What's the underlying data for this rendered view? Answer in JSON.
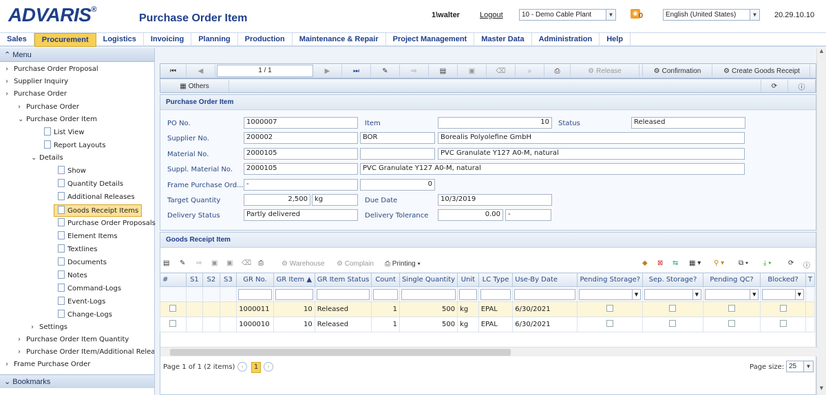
{
  "header": {
    "logo": "ADVARIS",
    "reg": "®",
    "title": "Purchase Order Item",
    "user": "1\\walter",
    "logout": "Logout",
    "plant": "10 - Demo Cable Plant",
    "notif_count": "0",
    "language": "English (United States)",
    "version": "20.29.10.10"
  },
  "menubar": [
    "Sales",
    "Procurement",
    "Logistics",
    "Invoicing",
    "Planning",
    "Production",
    "Maintenance & Repair",
    "Project Management",
    "Master Data",
    "Administration",
    "Help"
  ],
  "sidebar": {
    "menu": "Menu",
    "bookmarks": "Bookmarks",
    "items": [
      "Purchase Order Proposal",
      "Supplier Inquiry",
      "Purchase Order",
      "Purchase Order",
      "Purchase Order Item",
      "List View",
      "Report Layouts",
      "Details",
      "Show",
      "Quantity Details",
      "Additional Releases",
      "Goods Receipt Items",
      "Purchase Order Proposals",
      "Element Items",
      "Textlines",
      "Documents",
      "Notes",
      "Command-Logs",
      "Event-Logs",
      "Change-Logs",
      "Settings",
      "Purchase Order Item Quantity",
      "Purchase Order Item/Additional Releases",
      "Frame Purchase Order"
    ]
  },
  "toolbar": {
    "page": "1 / 1",
    "release": "Release",
    "confirmation": "Confirmation",
    "create_gr": "Create Goods Receipt",
    "others": "Others"
  },
  "form": {
    "section": "Purchase Order Item",
    "po_no_l": "PO No.",
    "po_no": "1000007",
    "item_l": "Item",
    "item": "10",
    "status_l": "Status",
    "status": "Released",
    "supplier_l": "Supplier No.",
    "supplier": "200002",
    "supplier_code": "BOR",
    "supplier_name": "Borealis Polyolefine GmbH",
    "material_l": "Material No.",
    "material": "2000105",
    "material_name": "PVC Granulate Y127 A0-M, natural",
    "suppl_mat_l": "Suppl. Material No.",
    "suppl_mat": "2000105",
    "suppl_mat_name": "PVC Granulate Y127 A0-M, natural",
    "frame_l": "Frame Purchase Ord...",
    "frame": "-",
    "frame_val": "0",
    "target_l": "Target Quantity",
    "target": "2,500",
    "unit": "kg",
    "due_l": "Due Date",
    "due": "10/3/2019",
    "dstatus_l": "Delivery Status",
    "dstatus": "Partly delivered",
    "tol_l": "Delivery Tolerance",
    "tol": "0.00",
    "tol_unit": "-"
  },
  "grid": {
    "section": "Goods Receipt Item",
    "warehouse": "Warehouse",
    "complain": "Complain",
    "printing": "Printing",
    "columns": [
      "#",
      "S1",
      "S2",
      "S3",
      "GR No.",
      "GR Item",
      "GR Item Status",
      "Count",
      "Single Quantity",
      "Unit",
      "LC Type",
      "Use-By Date",
      "Pending Storage?",
      "Sep. Storage?",
      "Pending QC?",
      "Blocked?",
      "T"
    ],
    "rows": [
      [
        "1000011",
        "10",
        "Released",
        "1",
        "500",
        "kg",
        "EPAL",
        "6/30/2021"
      ],
      [
        "1000010",
        "10",
        "Released",
        "1",
        "500",
        "kg",
        "EPAL",
        "6/30/2021"
      ]
    ],
    "footer": "Page 1 of 1 (2 items)",
    "page": "1",
    "page_size_l": "Page size:",
    "page_size": "25"
  }
}
